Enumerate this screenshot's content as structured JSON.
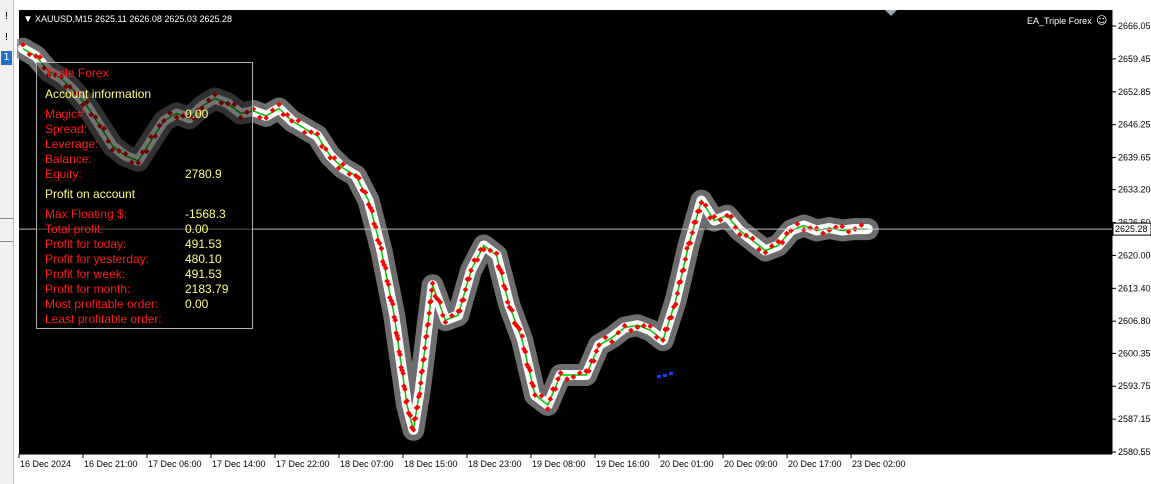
{
  "toolbar": {
    "btn1": "!",
    "btn2": "!",
    "btn3": "1"
  },
  "chart": {
    "symbol_line": "XAUUSD,M15  2625.11 2626.08 2625.03 2625.28",
    "ea_label": "EA_Triple Forex",
    "current_price": "2625.28",
    "price_axis": [
      "2666.05",
      "2659.45",
      "2652.85",
      "2646.25",
      "2639.65",
      "2633.20",
      "2626.60",
      "2620.00",
      "2613.40",
      "2606.80",
      "2600.35",
      "2593.75",
      "2587.15",
      "2580.55"
    ],
    "time_axis": [
      "16 Dec 2024",
      "16 Dec 21:00",
      "17 Dec 06:00",
      "17 Dec 14:00",
      "17 Dec 22:00",
      "18 Dec 07:00",
      "18 Dec 15:00",
      "18 Dec 23:00",
      "19 Dec 08:00",
      "19 Dec 16:00",
      "20 Dec 01:00",
      "20 Dec 09:00",
      "20 Dec 17:00",
      "23 Dec 02:00"
    ],
    "colors": {
      "background": "#000000",
      "text": "#ffffff",
      "grid": "#c0c0c0",
      "bull": "#00c800",
      "marker": "#ff0000",
      "halo": "#808080",
      "blue": "#1e3cff"
    }
  },
  "chart_data": {
    "type": "line",
    "title": "XAUUSD,M15",
    "ylim": [
      2580.55,
      2666.05
    ],
    "y_ticks": [
      2666.05,
      2659.45,
      2652.85,
      2646.25,
      2639.65,
      2633.2,
      2626.6,
      2620.0,
      2613.4,
      2606.8,
      2600.35,
      2593.75,
      2587.15,
      2580.55
    ],
    "x_ticks": [
      "16 Dec 2024",
      "16 Dec 21:00",
      "17 Dec 06:00",
      "17 Dec 14:00",
      "17 Dec 22:00",
      "18 Dec 07:00",
      "18 Dec 15:00",
      "18 Dec 23:00",
      "19 Dec 08:00",
      "19 Dec 16:00",
      "20 Dec 01:00",
      "20 Dec 09:00",
      "20 Dec 17:00",
      "23 Dec 02:00"
    ],
    "current_price": 2625.28,
    "x": [
      0,
      0.2,
      0.4,
      0.6,
      0.8,
      1,
      1.2,
      1.4,
      1.6,
      1.8,
      2,
      2.2,
      2.4,
      2.6,
      2.8,
      3,
      3.2,
      3.4,
      3.6,
      3.8,
      4,
      4.2,
      4.4,
      4.6,
      4.8,
      5,
      5.2,
      5.4,
      5.6,
      5.8,
      6,
      6.1,
      6.2,
      6.4,
      6.6,
      6.8,
      7,
      7.2,
      7.4,
      7.6,
      7.8,
      8,
      8.2,
      8.4,
      8.6,
      8.8,
      9,
      9.2,
      9.4,
      9.6,
      9.8,
      10,
      10.2,
      10.4,
      10.6,
      10.8,
      11,
      11.2,
      11.4,
      11.6,
      11.8,
      12,
      12.2,
      12.4,
      12.6,
      12.8,
      13,
      13.2
    ],
    "y": [
      2661.5,
      2660.0,
      2657.0,
      2655.5,
      2653.0,
      2650.0,
      2646.0,
      2642.0,
      2640.0,
      2639.0,
      2643.0,
      2647.0,
      2648.5,
      2647.5,
      2650.0,
      2651.5,
      2650.5,
      2648.5,
      2649.0,
      2648.0,
      2649.5,
      2647.0,
      2645.5,
      2644.0,
      2640.0,
      2637.5,
      2636.0,
      2631.0,
      2621.0,
      2608.0,
      2590.0,
      2585.0,
      2593.0,
      2614.0,
      2607.0,
      2608.0,
      2617.0,
      2622.0,
      2620.0,
      2610.0,
      2603.0,
      2592.0,
      2590.0,
      2596.0,
      2596.0,
      2596.0,
      2602.0,
      2603.5,
      2605.5,
      2606.0,
      2605.0,
      2603.0,
      2611.0,
      2622.0,
      2631.0,
      2627.0,
      2628.0,
      2625.0,
      2623.0,
      2621.0,
      2622.0,
      2625.0,
      2626.0,
      2625.0,
      2625.5,
      2625.0,
      2625.3,
      2625.28
    ]
  },
  "panel": {
    "title": "Triple Forex",
    "account_header": "Account information",
    "labels": {
      "magic": "Magic#:",
      "spread": "Spread:",
      "leverage": "Leverage:",
      "balance": "Balance:",
      "equity": "Equity:"
    },
    "values": {
      "magic": "0.00",
      "equity": "2780.9"
    },
    "profit_header": "Profit on account",
    "rows": [
      {
        "label": "Max Floating $:",
        "value": "-1568.3"
      },
      {
        "label": "Total profit:",
        "value": "0.00"
      },
      {
        "label": "Profit for today:",
        "value": "491.53"
      },
      {
        "label": "Profit for yesterday:",
        "value": "480.10"
      },
      {
        "label": "Profit for week:",
        "value": "491.53"
      },
      {
        "label": "Profit for month:",
        "value": "2183.79"
      },
      {
        "label": "Most profitable order:",
        "value": "0.00"
      },
      {
        "label": "Least profitable order:",
        "value": ""
      }
    ]
  }
}
